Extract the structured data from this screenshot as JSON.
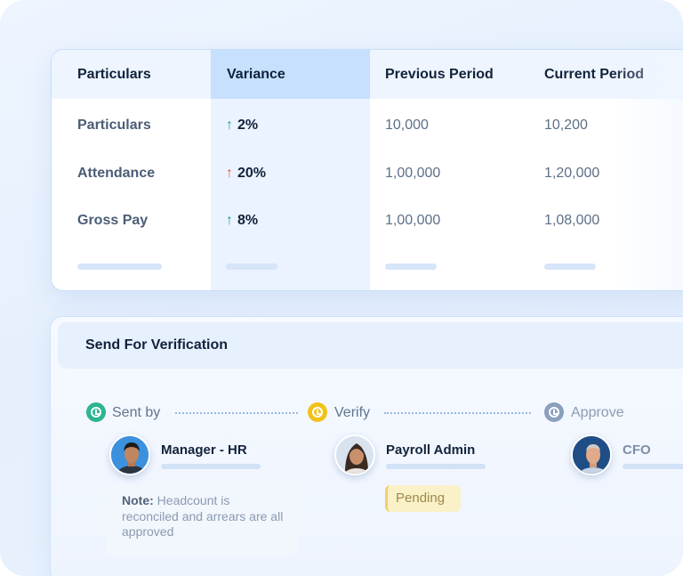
{
  "table": {
    "headers": [
      "Particulars",
      "Variance",
      "Previous Period",
      "Current Period"
    ],
    "rows": [
      {
        "label": "Particulars",
        "variance": "2%",
        "trend": "up",
        "trend_color": "#20a886",
        "previous": "10,000",
        "current": "10,200"
      },
      {
        "label": "Attendance",
        "variance": "20%",
        "trend": "up",
        "trend_color": "#e2574c",
        "previous": "1,00,000",
        "current": "1,20,000"
      },
      {
        "label": "Gross Pay",
        "variance": "8%",
        "trend": "up",
        "trend_color": "#20a886",
        "previous": "1,00,000",
        "current": "1,08,000"
      }
    ],
    "arrow_glyph": "↑"
  },
  "verification": {
    "title": "Send For Verification",
    "steps": [
      {
        "label": "Sent by",
        "icon": "clock-icon",
        "icon_color": "#2cb592",
        "person": "Manager - HR"
      },
      {
        "label": "Verify",
        "icon": "clock-icon",
        "icon_color": "#f1c21b",
        "person": "Payroll Admin",
        "status": "Pending"
      },
      {
        "label": "Approve",
        "icon": "clock-icon",
        "icon_color": "#8aa0bd",
        "person": "CFO"
      }
    ],
    "note": {
      "label": "Note:",
      "text": " Headcount is reconciled and arrears are all approved"
    }
  },
  "colors": {
    "accent": "#c6e0fd",
    "positive": "#20a886",
    "negative": "#e2574c",
    "pending": "#fbf1c9"
  }
}
